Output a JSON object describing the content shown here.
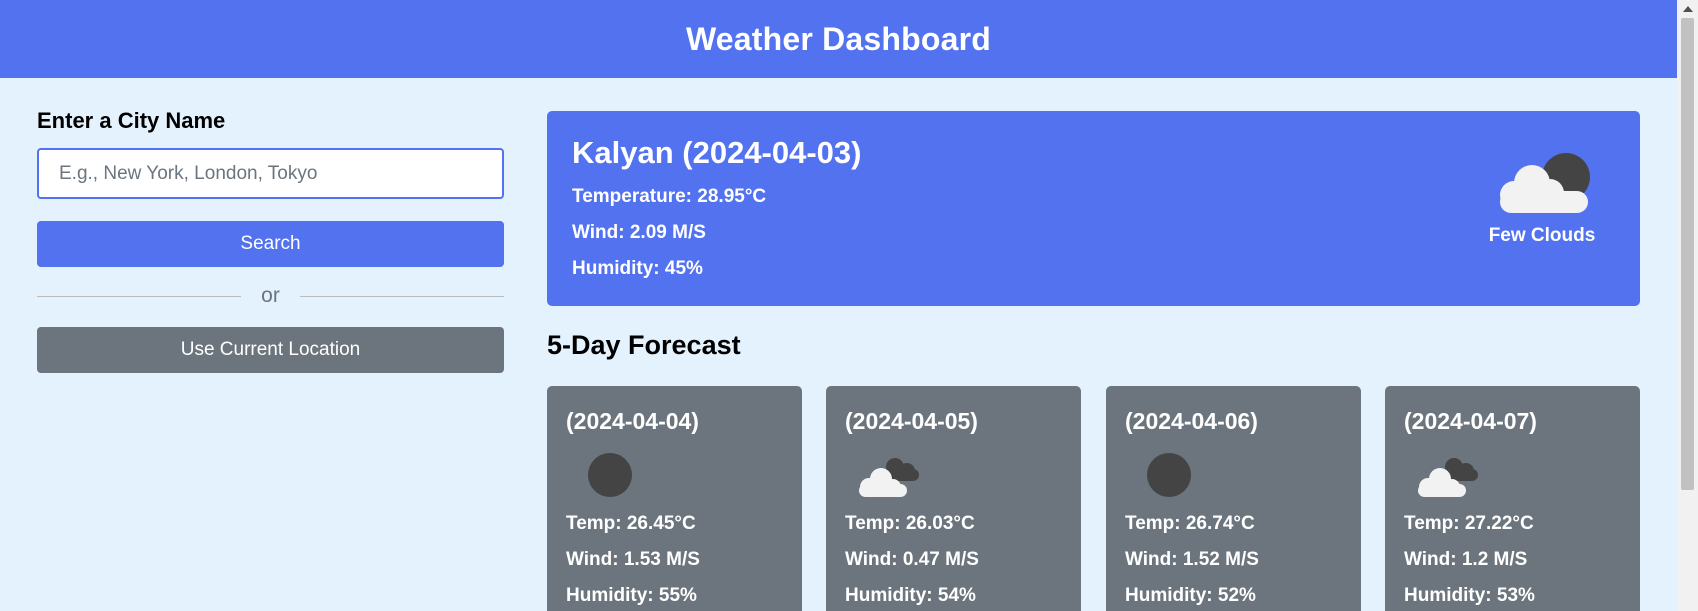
{
  "header": {
    "title": "Weather Dashboard"
  },
  "search": {
    "label": "Enter a City Name",
    "placeholder": "E.g., New York, London, Tokyo",
    "value": "",
    "search_label": "Search",
    "separator_text": "or",
    "location_label": "Use Current Location"
  },
  "current": {
    "title": "Kalyan (2024-04-03)",
    "temperature": "Temperature: 28.95°C",
    "wind": "Wind: 2.09 M/S",
    "humidity": "Humidity: 45%",
    "description": "Few Clouds",
    "icon": "few-clouds-night-icon"
  },
  "forecast": {
    "title": "5-Day Forecast",
    "days": [
      {
        "date": "(2024-04-04)",
        "temp": "Temp: 26.45°C",
        "wind": "Wind: 1.53 M/S",
        "humidity": "Humidity: 55%",
        "icon": "clear-night-icon"
      },
      {
        "date": "(2024-04-05)",
        "temp": "Temp: 26.03°C",
        "wind": "Wind: 0.47 M/S",
        "humidity": "Humidity: 54%",
        "icon": "broken-clouds-icon"
      },
      {
        "date": "(2024-04-06)",
        "temp": "Temp: 26.74°C",
        "wind": "Wind: 1.52 M/S",
        "humidity": "Humidity: 52%",
        "icon": "clear-night-icon"
      },
      {
        "date": "(2024-04-07)",
        "temp": "Temp: 27.22°C",
        "wind": "Wind: 1.2 M/S",
        "humidity": "Humidity: 53%",
        "icon": "broken-clouds-icon"
      }
    ]
  },
  "colors": {
    "primary": "#5372f0",
    "secondary": "#6c757d",
    "background": "#e3f2fd"
  }
}
